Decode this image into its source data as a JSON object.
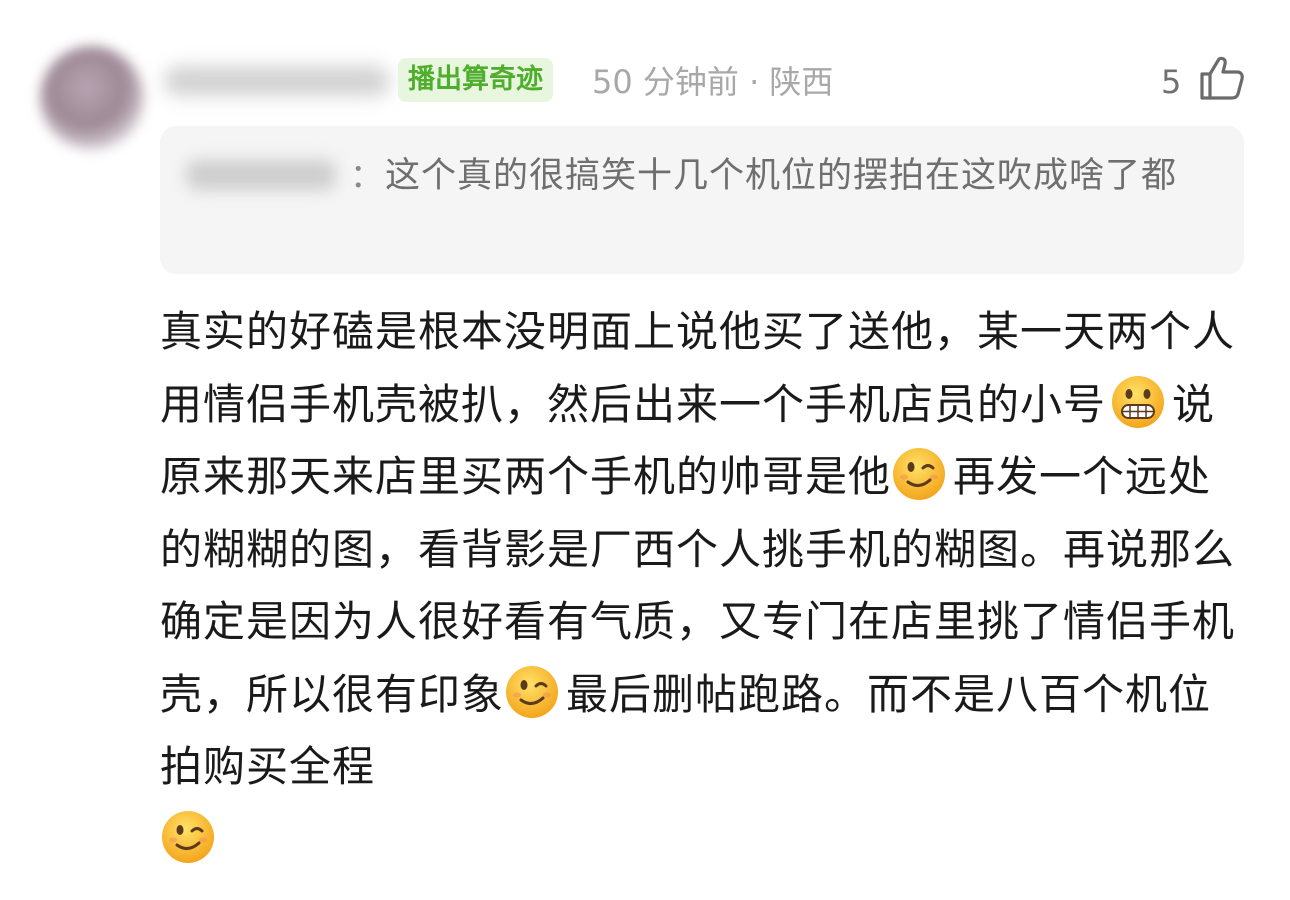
{
  "comment": {
    "badge": "播出算奇迹",
    "meta": "50 分钟前 · 陕西",
    "like_count": "5",
    "quote": {
      "colon": "：",
      "text": "这个真的很搞笑十几个机位的摆拍在这吹成啥了都"
    },
    "body": {
      "seg1": "真实的好磕是根本没明面上说他买了送他，某一天两个人用情侣手机壳被扒，然后出来一个手机店员的小号",
      "seg2": "说原来那天来店里买两个手机的帅哥是他",
      "seg3": "再发一个远处的糊糊的图，看背影是厂西个人挑手机的糊图。再说那么确定是因为人很好看有气质，又专门在店里挑了情侣手机壳，所以很有印象",
      "seg4": "最后删帖跑路。而不是八百个机位拍购买全程"
    },
    "icons": {
      "like": "thumbs-up-icon",
      "emoji_grimace": "grimacing-face-icon",
      "emoji_wink": "winking-face-icon"
    }
  }
}
